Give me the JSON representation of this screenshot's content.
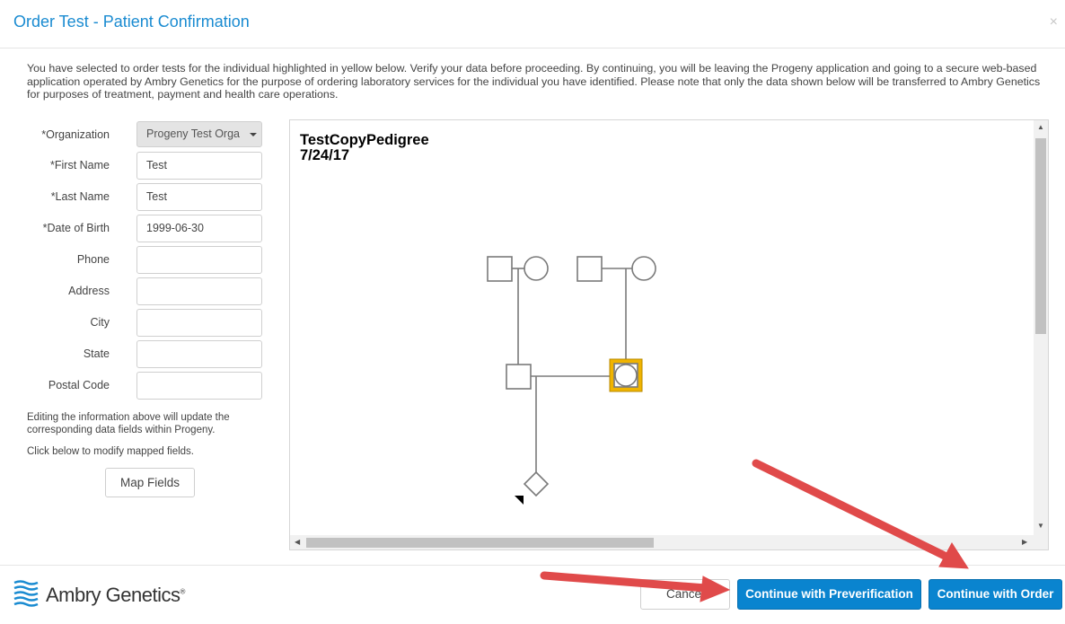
{
  "dialog": {
    "title": "Order Test - Patient Confirmation",
    "close_symbol": "×",
    "intro": "You have selected to order tests for the individual highlighted in yellow below. Verify your data before proceeding. By continuing, you will be leaving the Progeny application and going to a secure web-based application operated by Ambry Genetics for the purpose of ordering laboratory services for the individual you have identified. Please note that only the data shown below will be transferred to Ambry Genetics for purposes of treatment, payment and health care operations."
  },
  "form": {
    "organization": {
      "label": "*Organization",
      "value": "Progeny Test Orga"
    },
    "first_name": {
      "label": "*First Name",
      "value": "Test"
    },
    "last_name": {
      "label": "*Last Name",
      "value": "Test"
    },
    "dob": {
      "label": "*Date of Birth",
      "value": "1999-06-30"
    },
    "phone": {
      "label": "Phone",
      "value": ""
    },
    "address": {
      "label": "Address",
      "value": ""
    },
    "city": {
      "label": "City",
      "value": ""
    },
    "state": {
      "label": "State",
      "value": ""
    },
    "postal_code": {
      "label": "Postal Code",
      "value": ""
    },
    "note_edit": "Editing the information above will update the corresponding data fields within Progeny.",
    "note_map": "Click below to modify mapped fields.",
    "map_fields_label": "Map Fields"
  },
  "pedigree": {
    "name": "TestCopyPedigree",
    "date": "7/24/17",
    "highlight_color": "#f0b400"
  },
  "footer": {
    "logo_text": "Ambry Genetics",
    "logo_mark": "®",
    "cancel_label": "Cancel",
    "prever_label": "Continue with Preverification",
    "order_label": "Continue with Order"
  },
  "colors": {
    "accent": "#1a8bd1",
    "primary_button": "#0a84cf",
    "annotation_arrow": "#e04a4a"
  }
}
